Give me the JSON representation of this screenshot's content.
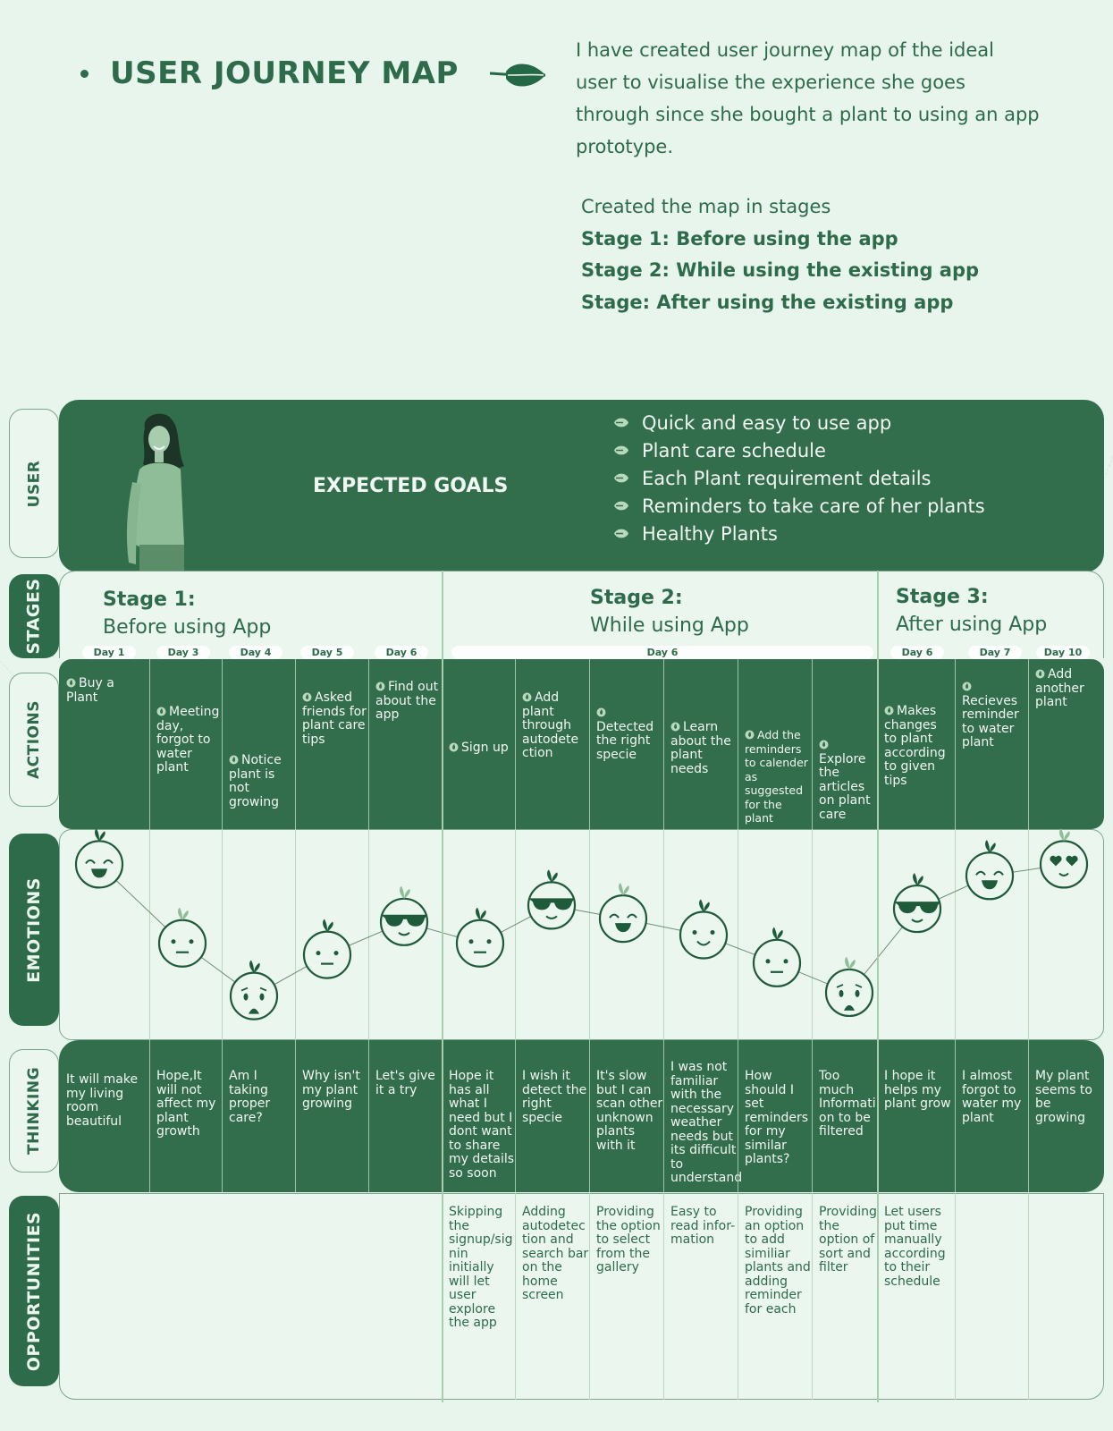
{
  "header": {
    "title": "USER JOURNEY MAP",
    "intro": "I have created user journey map of the ideal user  to visualise the experience she goes through since she bought a plant to using an app prototype.",
    "stages_intro": "Created the map in stages",
    "stage_lines": [
      "Stage 1: Before using the app",
      "Stage 2: While using the existing app",
      "Stage: After using the existing app"
    ]
  },
  "row_labels": {
    "user": "USER",
    "stages": "STAGES",
    "actions": "ACTIONS",
    "emotions": "EMOTIONS",
    "thinking": "THINKING",
    "opportunities": "OPPORTUNITIES"
  },
  "user": {
    "goals_title": "EXPECTED GOALS",
    "goals": [
      "Quick and easy to use app",
      "Plant care schedule",
      "Each Plant requirement details",
      "Reminders to take care of her plants",
      "Healthy Plants"
    ]
  },
  "stages": [
    {
      "number": "Stage 1:",
      "name": "Before using App"
    },
    {
      "number": "Stage 2:",
      "name": "While using App"
    },
    {
      "number": "Stage 3:",
      "name": "After using App"
    }
  ],
  "days": [
    "Day 1",
    "Day 3",
    "Day 4",
    "Day 5",
    "Day 6",
    "Day 6",
    "Day 6",
    "Day 7",
    "Day 10"
  ],
  "actions": [
    "Buy a Plant",
    "Meeting day, forgot to water plant",
    "Notice plant is not growing",
    "Asked friends for plant care tips",
    "Find out about the app",
    "Sign up",
    "Add plant through autodete ction",
    "Detected the right specie",
    "Learn about the plant needs",
    "Add the reminders to calender as suggested for the plant",
    "Explore the articles on plant care",
    "Makes changes to plant according to given tips",
    "Recieves reminder to water plant",
    "Add another plant"
  ],
  "emotions": [
    {
      "face": "happy",
      "level": 0.9
    },
    {
      "face": "neutral",
      "level": 0.42
    },
    {
      "face": "worried",
      "level": 0.1
    },
    {
      "face": "neutral",
      "level": 0.35
    },
    {
      "face": "cool",
      "level": 0.55
    },
    {
      "face": "neutral",
      "level": 0.42
    },
    {
      "face": "cool",
      "level": 0.65
    },
    {
      "face": "happy",
      "level": 0.57
    },
    {
      "face": "smile",
      "level": 0.47
    },
    {
      "face": "neutral",
      "level": 0.3
    },
    {
      "face": "worried",
      "level": 0.12
    },
    {
      "face": "cool",
      "level": 0.63
    },
    {
      "face": "happy",
      "level": 0.83
    },
    {
      "face": "love",
      "level": 0.9
    }
  ],
  "thinking": [
    "It will make my living room beautiful",
    "Hope,It will not affect my plant growth",
    "Am I taking proper care?",
    "Why isn't my plant growing",
    "Let's give it a try",
    "Hope it has all what I need but I dont want to share my details so soon",
    "I wish it detect the right specie",
    "It's slow but I can scan other unknown plants with it",
    "I was not familiar with the necessary weather needs but its difficult to understand",
    "How should I set reminders for my similar plants?",
    "Too much Informati on to be filtered",
    "I hope it helps my plant grow",
    "I almost forgot to water my plant",
    "My plant seems to be growing"
  ],
  "opportunities": [
    "",
    "",
    "",
    "",
    "",
    "Skipping the signup/sig nin initially will let user explore the app",
    "Adding autodetec tion and search bar on the home screen",
    "Providing the option to select from the gallery",
    "Easy to read infor- mation",
    "Providing an option to add similiar plants and adding reminder for each",
    "Providing the option of sort and filter",
    "Let users put time manually according to their schedule",
    "",
    ""
  ],
  "colors": {
    "background": "#e8f5ec",
    "primary_green": "#326e4c",
    "text_green": "#2e6b4a",
    "light_text": "#f1f7f2"
  }
}
